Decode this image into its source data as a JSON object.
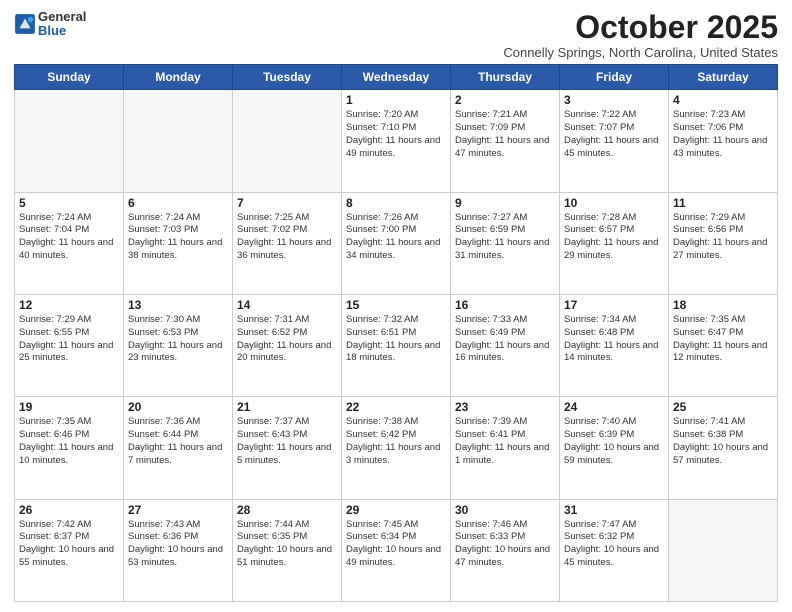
{
  "header": {
    "logo_general": "General",
    "logo_blue": "Blue",
    "title": "October 2025",
    "location": "Connelly Springs, North Carolina, United States"
  },
  "days_of_week": [
    "Sunday",
    "Monday",
    "Tuesday",
    "Wednesday",
    "Thursday",
    "Friday",
    "Saturday"
  ],
  "weeks": [
    [
      {
        "day": "",
        "info": ""
      },
      {
        "day": "",
        "info": ""
      },
      {
        "day": "",
        "info": ""
      },
      {
        "day": "1",
        "info": "Sunrise: 7:20 AM\nSunset: 7:10 PM\nDaylight: 11 hours and 49 minutes."
      },
      {
        "day": "2",
        "info": "Sunrise: 7:21 AM\nSunset: 7:09 PM\nDaylight: 11 hours and 47 minutes."
      },
      {
        "day": "3",
        "info": "Sunrise: 7:22 AM\nSunset: 7:07 PM\nDaylight: 11 hours and 45 minutes."
      },
      {
        "day": "4",
        "info": "Sunrise: 7:23 AM\nSunset: 7:06 PM\nDaylight: 11 hours and 43 minutes."
      }
    ],
    [
      {
        "day": "5",
        "info": "Sunrise: 7:24 AM\nSunset: 7:04 PM\nDaylight: 11 hours and 40 minutes."
      },
      {
        "day": "6",
        "info": "Sunrise: 7:24 AM\nSunset: 7:03 PM\nDaylight: 11 hours and 38 minutes."
      },
      {
        "day": "7",
        "info": "Sunrise: 7:25 AM\nSunset: 7:02 PM\nDaylight: 11 hours and 36 minutes."
      },
      {
        "day": "8",
        "info": "Sunrise: 7:26 AM\nSunset: 7:00 PM\nDaylight: 11 hours and 34 minutes."
      },
      {
        "day": "9",
        "info": "Sunrise: 7:27 AM\nSunset: 6:59 PM\nDaylight: 11 hours and 31 minutes."
      },
      {
        "day": "10",
        "info": "Sunrise: 7:28 AM\nSunset: 6:57 PM\nDaylight: 11 hours and 29 minutes."
      },
      {
        "day": "11",
        "info": "Sunrise: 7:29 AM\nSunset: 6:56 PM\nDaylight: 11 hours and 27 minutes."
      }
    ],
    [
      {
        "day": "12",
        "info": "Sunrise: 7:29 AM\nSunset: 6:55 PM\nDaylight: 11 hours and 25 minutes."
      },
      {
        "day": "13",
        "info": "Sunrise: 7:30 AM\nSunset: 6:53 PM\nDaylight: 11 hours and 23 minutes."
      },
      {
        "day": "14",
        "info": "Sunrise: 7:31 AM\nSunset: 6:52 PM\nDaylight: 11 hours and 20 minutes."
      },
      {
        "day": "15",
        "info": "Sunrise: 7:32 AM\nSunset: 6:51 PM\nDaylight: 11 hours and 18 minutes."
      },
      {
        "day": "16",
        "info": "Sunrise: 7:33 AM\nSunset: 6:49 PM\nDaylight: 11 hours and 16 minutes."
      },
      {
        "day": "17",
        "info": "Sunrise: 7:34 AM\nSunset: 6:48 PM\nDaylight: 11 hours and 14 minutes."
      },
      {
        "day": "18",
        "info": "Sunrise: 7:35 AM\nSunset: 6:47 PM\nDaylight: 11 hours and 12 minutes."
      }
    ],
    [
      {
        "day": "19",
        "info": "Sunrise: 7:35 AM\nSunset: 6:46 PM\nDaylight: 11 hours and 10 minutes."
      },
      {
        "day": "20",
        "info": "Sunrise: 7:36 AM\nSunset: 6:44 PM\nDaylight: 11 hours and 7 minutes."
      },
      {
        "day": "21",
        "info": "Sunrise: 7:37 AM\nSunset: 6:43 PM\nDaylight: 11 hours and 5 minutes."
      },
      {
        "day": "22",
        "info": "Sunrise: 7:38 AM\nSunset: 6:42 PM\nDaylight: 11 hours and 3 minutes."
      },
      {
        "day": "23",
        "info": "Sunrise: 7:39 AM\nSunset: 6:41 PM\nDaylight: 11 hours and 1 minute."
      },
      {
        "day": "24",
        "info": "Sunrise: 7:40 AM\nSunset: 6:39 PM\nDaylight: 10 hours and 59 minutes."
      },
      {
        "day": "25",
        "info": "Sunrise: 7:41 AM\nSunset: 6:38 PM\nDaylight: 10 hours and 57 minutes."
      }
    ],
    [
      {
        "day": "26",
        "info": "Sunrise: 7:42 AM\nSunset: 6:37 PM\nDaylight: 10 hours and 55 minutes."
      },
      {
        "day": "27",
        "info": "Sunrise: 7:43 AM\nSunset: 6:36 PM\nDaylight: 10 hours and 53 minutes."
      },
      {
        "day": "28",
        "info": "Sunrise: 7:44 AM\nSunset: 6:35 PM\nDaylight: 10 hours and 51 minutes."
      },
      {
        "day": "29",
        "info": "Sunrise: 7:45 AM\nSunset: 6:34 PM\nDaylight: 10 hours and 49 minutes."
      },
      {
        "day": "30",
        "info": "Sunrise: 7:46 AM\nSunset: 6:33 PM\nDaylight: 10 hours and 47 minutes."
      },
      {
        "day": "31",
        "info": "Sunrise: 7:47 AM\nSunset: 6:32 PM\nDaylight: 10 hours and 45 minutes."
      },
      {
        "day": "",
        "info": ""
      }
    ]
  ]
}
